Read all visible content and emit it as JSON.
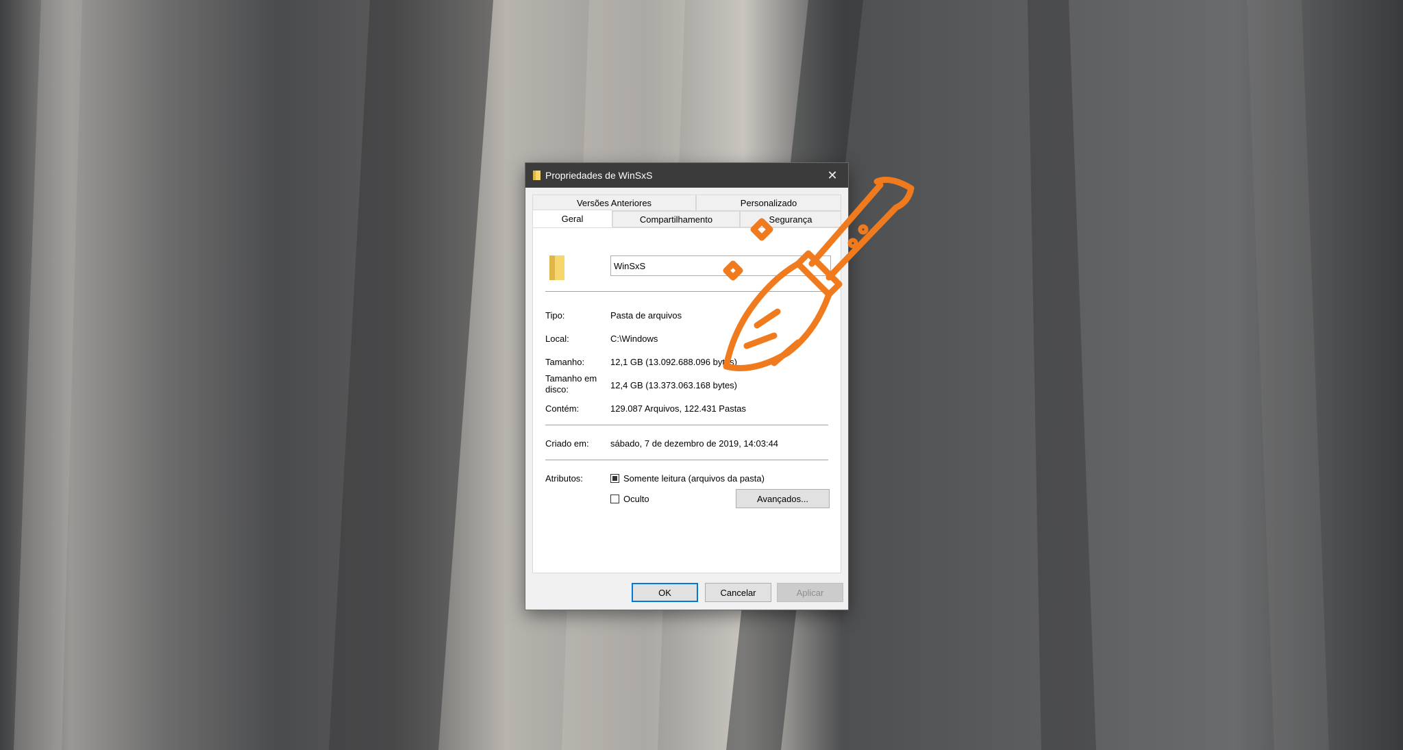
{
  "window": {
    "title": "Propriedades de WinSxS",
    "close_glyph": "✕"
  },
  "tabs": {
    "back_row": [
      "Versões Anteriores",
      "Personalizado"
    ],
    "front_row": [
      "Geral",
      "Compartilhamento",
      "Segurança"
    ],
    "active": "Geral"
  },
  "general": {
    "name_value": "WinSxS",
    "rows": [
      {
        "label": "Tipo:",
        "value": "Pasta de arquivos"
      },
      {
        "label": "Local:",
        "value": "C:\\Windows"
      },
      {
        "label": "Tamanho:",
        "value": "12,1 GB (13.092.688.096 bytes)"
      },
      {
        "label": "Tamanho em disco:",
        "value": "12,4 GB (13.373.063.168 bytes)"
      },
      {
        "label": "Contém:",
        "value": "129.087 Arquivos, 122.431 Pastas"
      },
      {
        "label": "Criado em:",
        "value": "sábado, 7 de dezembro de 2019, 14:03:44"
      },
      {
        "label": "Atributos:",
        "value": ""
      }
    ],
    "attributes": {
      "readonly_label": "Somente leitura (arquivos da pasta)",
      "readonly_state": "indeterminate",
      "hidden_label": "Oculto",
      "hidden_checked": false,
      "advanced_button": "Avançados..."
    }
  },
  "buttons": {
    "ok": "OK",
    "cancel": "Cancelar",
    "apply": "Aplicar"
  },
  "icons": {
    "title_icon": "folder-icon",
    "folder_icon": "folder-icon",
    "overlay": "broom-icon"
  },
  "colors": {
    "titlebar": "#3b3b3b",
    "accent": "#0078d7",
    "folder": "#f8d66e",
    "broom": "#f07a1e"
  }
}
